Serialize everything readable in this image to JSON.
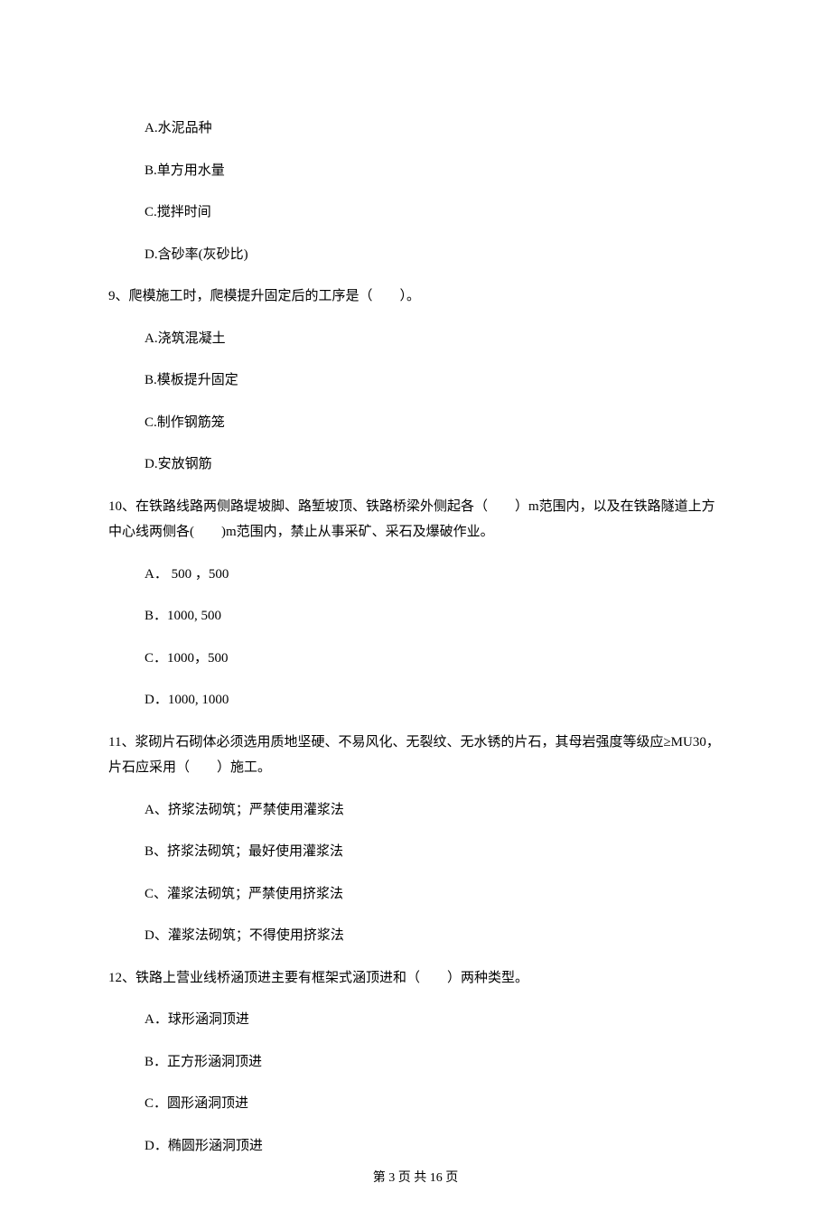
{
  "options_pre_q9": [
    "A.水泥品种",
    "B.单方用水量",
    "C.搅拌时间",
    "D.含砂率(灰砂比)"
  ],
  "q9": {
    "stem": "9、爬模施工时，爬模提升固定后的工序是（　　）。",
    "options": [
      "A.浇筑混凝土",
      "B.模板提升固定",
      "C.制作钢筋笼",
      "D.安放钢筋"
    ]
  },
  "q10": {
    "stem": "10、在铁路线路两侧路堤坡脚、路堑坡顶、铁路桥梁外侧起各（　　）m范围内，以及在铁路隧道上方中心线两侧各(　　)m范围内，禁止从事采矿、采石及爆破作业。",
    "options": [
      "A． 500 ，500",
      "B．1000, 500",
      "C．1000，500",
      "D．1000, 1000"
    ]
  },
  "q11": {
    "stem": "11、浆砌片石砌体必须选用质地坚硬、不易风化、无裂纹、无水锈的片石，其母岩强度等级应≥MU30，片石应采用（　　）施工。",
    "options": [
      "A、挤浆法砌筑；严禁使用灌浆法",
      "B、挤浆法砌筑；最好使用灌浆法",
      "C、灌浆法砌筑；严禁使用挤浆法",
      "D、灌浆法砌筑；不得使用挤浆法"
    ]
  },
  "q12": {
    "stem": "12、铁路上营业线桥涵顶进主要有框架式涵顶进和（　　）两种类型。",
    "options": [
      "A．球形涵洞顶进",
      "B．正方形涵洞顶进",
      "C．圆形涵洞顶进",
      "D．椭圆形涵洞顶进"
    ]
  },
  "footer": "第 3 页 共 16 页"
}
